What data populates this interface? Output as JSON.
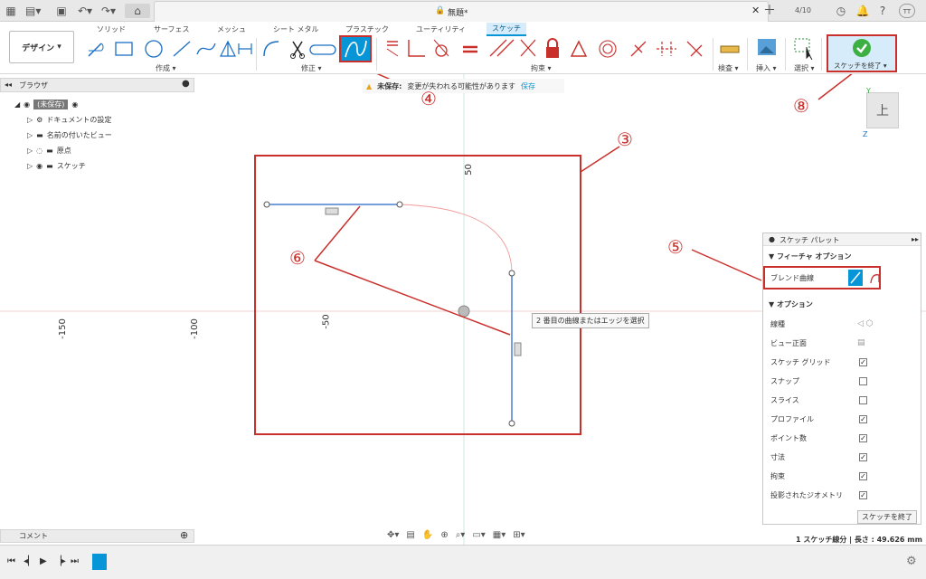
{
  "window": {
    "title": "無題*",
    "job_count": "4/10",
    "user_initials": "TT"
  },
  "design_button": "デザイン",
  "tabs": [
    "ソリッド",
    "サーフェス",
    "メッシュ",
    "シート メタル",
    "プラスチック",
    "ユーティリティ",
    "スケッチ"
  ],
  "groups": {
    "create": "作成",
    "modify": "修正",
    "constraints": "拘束",
    "inspect": "検査",
    "insert": "挿入",
    "select": "選択",
    "finish": "スケッチを終了"
  },
  "notice": {
    "label": "未保存:",
    "text": "変更が失われる可能性があります",
    "save": "保存"
  },
  "browser": {
    "title": "ブラウザ",
    "items": [
      "(未保存)",
      "ドキュメントの設定",
      "名前の付いたビュー",
      "原点",
      "スケッチ"
    ]
  },
  "canvas": {
    "axis_labels": [
      "-150",
      "-100",
      "-50",
      "50"
    ],
    "tooltip": "2 番目の曲線またはエッジを選択",
    "view_cube": "上",
    "axis_y": "Y",
    "axis_z": "Z"
  },
  "palette": {
    "title": "スケッチ パレット",
    "feature_section": "フィーチャ オプション",
    "blend_label": "ブレンド曲線",
    "options_section": "オプション",
    "options": [
      {
        "label": "線種"
      },
      {
        "label": "ビュー正面"
      },
      {
        "label": "スケッチ グリッド",
        "checked": true
      },
      {
        "label": "スナップ",
        "checked": false
      },
      {
        "label": "スライス",
        "checked": false
      },
      {
        "label": "プロファイル",
        "checked": true
      },
      {
        "label": "ポイント数",
        "checked": true
      },
      {
        "label": "寸法",
        "checked": true
      },
      {
        "label": "拘束",
        "checked": true
      },
      {
        "label": "投影されたジオメトリ",
        "checked": true
      }
    ],
    "finish_button": "スケッチを終了"
  },
  "comment": "コメント",
  "status": "1 スケッチ線分 | 長さ : 49.626 mm",
  "callouts": [
    "③",
    "④",
    "⑤",
    "⑥",
    "⑧"
  ],
  "colors": {
    "accent": "#0696d7",
    "annotation": "#c9302c",
    "sketch_line": "#4a7fd4",
    "finish_green": "#3cb043"
  }
}
